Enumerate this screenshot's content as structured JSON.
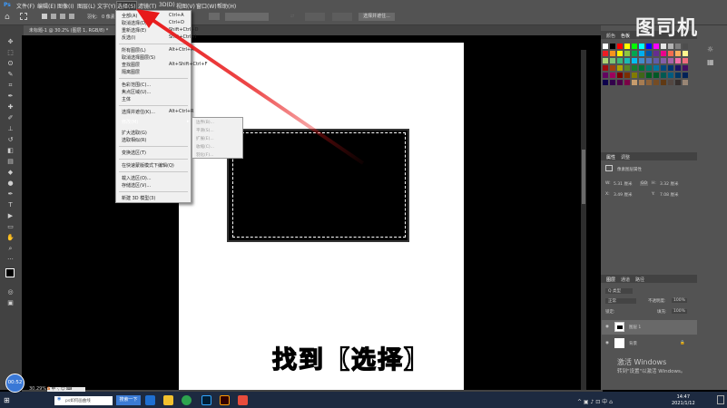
{
  "menubar": {
    "items": [
      "文件(F)",
      "编辑(E)",
      "图像(I)",
      "图层(L)",
      "文字(Y)",
      "选择(S)",
      "滤镜(T)",
      "3D(D)",
      "视图(V)",
      "窗口(W)",
      "帮助(H)"
    ]
  },
  "optionsbar": {
    "feather_label": "羽化:",
    "feather_value": "0 像素",
    "select_mask_button": "选择并遮住..."
  },
  "document_tab": {
    "title": "未标题-1 @ 30.2% (图层 1, RGB/8) *"
  },
  "select_menu": {
    "items": [
      {
        "label": "全部(A)",
        "shortcut": "Ctrl+A"
      },
      {
        "label": "取消选择(D)",
        "shortcut": "Ctrl+D"
      },
      {
        "label": "重新选择(E)",
        "shortcut": "Shift+Ctrl+D"
      },
      {
        "label": "反选(I)",
        "shortcut": "Shift+Ctrl+I"
      },
      {
        "label": "所有图层(L)",
        "shortcut": "Alt+Ctrl+A"
      },
      {
        "label": "取消选择图层(S)",
        "shortcut": ""
      },
      {
        "label": "查找图层",
        "shortcut": "Alt+Shift+Ctrl+F"
      },
      {
        "label": "隔离图层",
        "shortcut": ""
      },
      {
        "label": "色彩范围(C)...",
        "shortcut": ""
      },
      {
        "label": "焦点区域(U)...",
        "shortcut": ""
      },
      {
        "label": "主体",
        "shortcut": ""
      },
      {
        "label": "选择并遮住(K)...",
        "shortcut": "Alt+Ctrl+R"
      },
      {
        "label": "修改(M)",
        "shortcut": ""
      },
      {
        "label": "扩大选取(G)",
        "shortcut": ""
      },
      {
        "label": "选取相似(R)",
        "shortcut": ""
      },
      {
        "label": "变换选区(T)",
        "shortcut": ""
      },
      {
        "label": "在快速蒙版模式下编辑(Q)",
        "shortcut": ""
      },
      {
        "label": "载入选区(O)...",
        "shortcut": ""
      },
      {
        "label": "存储选区(V)...",
        "shortcut": ""
      },
      {
        "label": "新建 3D 模型(3)",
        "shortcut": ""
      }
    ]
  },
  "modify_submenu": {
    "items": [
      "边界(B)...",
      "平滑(S)...",
      "扩展(E)...",
      "收缩(C)...",
      "羽化(F)..."
    ]
  },
  "canvas": {
    "caption": "找到【选择】"
  },
  "right_panel": {
    "swatches_tabs": [
      "颜色",
      "色板"
    ],
    "properties_tabs": [
      "属性",
      "调整"
    ],
    "properties_title": "像素图层属性",
    "w_label": "W:",
    "w_value": "5.31 厘米",
    "go_label": "GO",
    "h_label": "H:",
    "h_value": "3.32 厘米",
    "x_label": "X:",
    "x_value": "3.49 厘米",
    "y_label": "Y:",
    "y_value": "7.08 厘米",
    "layers_tabs": [
      "图层",
      "通道",
      "路径"
    ],
    "kind_filter": "Q 类型",
    "blend_mode": "正常",
    "opacity_label": "不透明度:",
    "opacity_value": "100%",
    "lock_label": "锁定:",
    "fill_label": "填充:",
    "fill_value": "100%",
    "layers": [
      {
        "name": "图层 1"
      },
      {
        "name": "背景"
      }
    ],
    "swatch_colors": [
      "#ffffff",
      "#000000",
      "#ff0000",
      "#ffff00",
      "#00ff00",
      "#00ffff",
      "#0000ff",
      "#ff00ff",
      "#e6e6e6",
      "#b3b3b3",
      "#808080",
      "#4d4d4d",
      "#ed1c24",
      "#f7941d",
      "#fff200",
      "#8dc63f",
      "#00a651",
      "#00aeef",
      "#0054a6",
      "#662d91",
      "#ec008c",
      "#f26c4f",
      "#fbaf5d",
      "#fff68f",
      "#acd373",
      "#7cc576",
      "#3bb878",
      "#1abbb4",
      "#00bff3",
      "#438ccb",
      "#5574b9",
      "#605ca8",
      "#855fa8",
      "#a763a8",
      "#f06eaa",
      "#f26d7d",
      "#9e0b0f",
      "#a0410d",
      "#aba000",
      "#598527",
      "#197b30",
      "#007236",
      "#00746b",
      "#0076a3",
      "#004a80",
      "#003471",
      "#1b1464",
      "#440e62",
      "#630460",
      "#9e005d",
      "#790000",
      "#7b2e00",
      "#827b00",
      "#406618",
      "#005e20",
      "#005826",
      "#005952",
      "#005b7f",
      "#003663",
      "#002157",
      "#0d004c",
      "#32004b",
      "#4b0049",
      "#7b0046",
      "#c69c6d",
      "#a67c52",
      "#8c6239",
      "#754c24",
      "#603913",
      "#534741",
      "#362f2d",
      "#998675"
    ]
  },
  "overlay": {
    "logo": "图司机",
    "watermark_title": "激活 Windows",
    "watermark_sub": "转到\"设置\"以激活 Windows。"
  },
  "statusbar": {
    "zoom": "30.29%"
  },
  "taskbar": {
    "search_placeholder": "ps如何画曲线",
    "search_button": "搜索一下",
    "time": "14:47",
    "date": "2021/1/12",
    "recorder_time": "00:52"
  },
  "colors": {
    "accent_red_arrow": "#e8191a",
    "menu_highlight": "#2f72c5",
    "panel_bg": "#535353"
  }
}
